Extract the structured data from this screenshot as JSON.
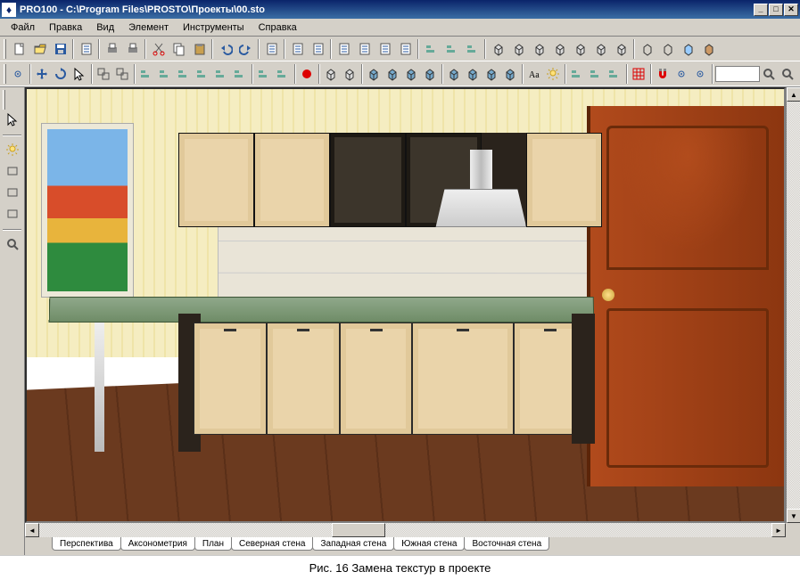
{
  "title": "PRO100 - C:\\Program Files\\PROSTO\\Проекты\\00.sto",
  "menu": [
    "Файл",
    "Правка",
    "Вид",
    "Элемент",
    "Инструменты",
    "Справка"
  ],
  "toolbar1": [
    {
      "name": "new-file-icon",
      "sep": false
    },
    {
      "name": "open-file-icon"
    },
    {
      "name": "save-file-icon"
    },
    {
      "sep": true
    },
    {
      "name": "library-icon"
    },
    {
      "sep": true
    },
    {
      "name": "print-icon"
    },
    {
      "name": "print-preview-icon"
    },
    {
      "sep": true
    },
    {
      "name": "cut-icon"
    },
    {
      "name": "copy-icon"
    },
    {
      "name": "paste-icon"
    },
    {
      "sep": true
    },
    {
      "name": "undo-icon"
    },
    {
      "name": "redo-icon"
    },
    {
      "sep": true
    },
    {
      "name": "properties-icon"
    },
    {
      "sep": true
    },
    {
      "name": "catalog-icon"
    },
    {
      "name": "materials-icon"
    },
    {
      "sep": true
    },
    {
      "name": "report-icon"
    },
    {
      "name": "pricelist-icon"
    },
    {
      "name": "spec-icon"
    },
    {
      "name": "cost-icon"
    },
    {
      "sep": true
    },
    {
      "name": "align-left-icon"
    },
    {
      "name": "align-center-icon"
    },
    {
      "name": "align-right-icon"
    },
    {
      "sep": true
    },
    {
      "name": "view-front-icon"
    },
    {
      "name": "view-back-icon"
    },
    {
      "name": "view-left-icon"
    },
    {
      "name": "view-right-icon"
    },
    {
      "name": "view-top-icon"
    },
    {
      "name": "view-bottom-icon"
    },
    {
      "name": "view-axo-icon"
    },
    {
      "sep": true
    },
    {
      "name": "wireframe-icon"
    },
    {
      "name": "hidden-line-icon"
    },
    {
      "name": "shaded-icon"
    },
    {
      "name": "textured-icon"
    }
  ],
  "toolbar2": [
    {
      "name": "snap-grid-icon"
    },
    {
      "sep": true
    },
    {
      "name": "move-icon"
    },
    {
      "name": "rotate-icon"
    },
    {
      "name": "select-icon"
    },
    {
      "sep": true
    },
    {
      "name": "group-icon"
    },
    {
      "name": "ungroup-icon"
    },
    {
      "sep": true
    },
    {
      "name": "align-t-icon"
    },
    {
      "name": "align-b-icon"
    },
    {
      "name": "align-l-icon"
    },
    {
      "name": "align-r-icon"
    },
    {
      "name": "align-hc-icon"
    },
    {
      "name": "align-vc-icon"
    },
    {
      "sep": true
    },
    {
      "name": "distribute-h-icon"
    },
    {
      "name": "distribute-v-icon"
    },
    {
      "sep": true
    },
    {
      "name": "layer-red-icon"
    },
    {
      "sep": true
    },
    {
      "name": "box1-icon"
    },
    {
      "name": "box2-icon"
    },
    {
      "sep": true
    },
    {
      "name": "face1-icon"
    },
    {
      "name": "face2-icon"
    },
    {
      "name": "face3-icon"
    },
    {
      "name": "face4-icon"
    },
    {
      "sep": true
    },
    {
      "name": "face5-icon"
    },
    {
      "name": "face6-icon"
    },
    {
      "name": "face7-icon"
    },
    {
      "name": "face8-icon"
    },
    {
      "sep": true
    },
    {
      "name": "text-aa-icon"
    },
    {
      "name": "light-icon"
    },
    {
      "sep": true
    },
    {
      "name": "dim-h-icon"
    },
    {
      "name": "dim-v-icon"
    },
    {
      "name": "dim-g-icon"
    },
    {
      "sep": true
    },
    {
      "name": "grid-red-icon"
    },
    {
      "sep": true
    },
    {
      "name": "magnet-icon"
    },
    {
      "name": "snap-pt-icon"
    },
    {
      "name": "snap-ed-icon"
    },
    {
      "sep": true
    },
    {
      "input": true,
      "value": ""
    },
    {
      "name": "zoom-out-icon"
    },
    {
      "name": "zoom-in-icon"
    }
  ],
  "leftTools": [
    {
      "name": "cursor-icon"
    },
    {
      "divider": true
    },
    {
      "name": "light-tool-icon"
    },
    {
      "name": "panel-tool-icon"
    },
    {
      "name": "shape-tool-icon"
    },
    {
      "name": "extrude-tool-icon"
    },
    {
      "divider": true
    },
    {
      "name": "zoom-tool-icon"
    }
  ],
  "tabs": [
    "Перспектива",
    "Аксонометрия",
    "План",
    "Северная стена",
    "Западная стена",
    "Южная стена",
    "Восточная стена"
  ],
  "activeTab": 0,
  "caption": "Рис. 16  Замена текстур  в проекте"
}
